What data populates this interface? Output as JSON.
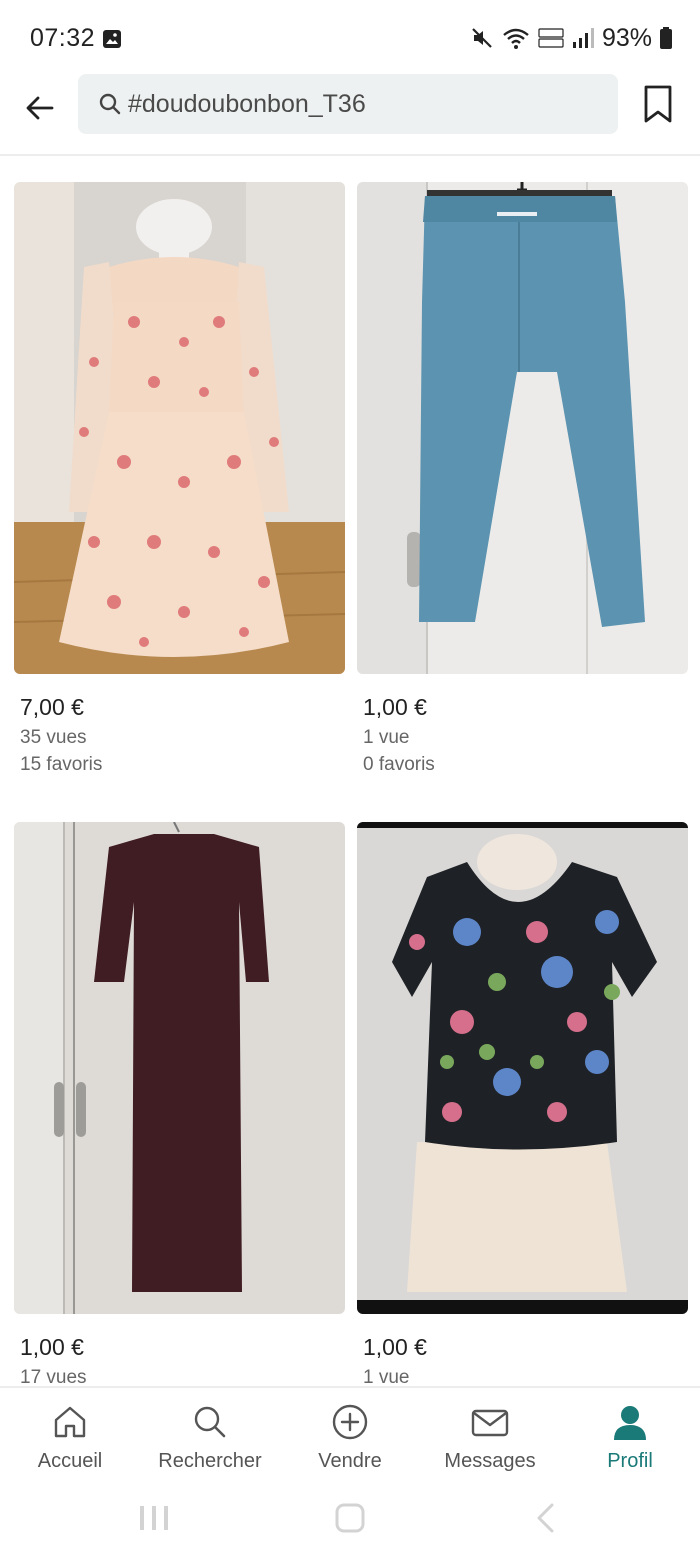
{
  "status_bar": {
    "time": "07:32",
    "battery": "93%",
    "icons": [
      "photo-icon",
      "mute-icon",
      "wifi-icon",
      "volte-icon",
      "signal-icon",
      "battery-icon"
    ]
  },
  "header": {
    "search_text": "#doudoubonbon_T36",
    "back_icon": "arrow-left-icon",
    "bookmark_icon": "bookmark-icon"
  },
  "items": [
    {
      "price": "7,00 €",
      "views": "35 vues",
      "favorites": "15 favoris",
      "image": "pink floral dress on mannequin"
    },
    {
      "price": "1,00 €",
      "views": "1 vue",
      "favorites": "0 favoris",
      "image": "blue trousers on hanger"
    },
    {
      "price": "1,00 €",
      "views": "17 vues",
      "favorites": "",
      "image": "long burgundy knit dress"
    },
    {
      "price": "1,00 €",
      "views": "1 vue",
      "favorites": "",
      "image": "black floral top on mannequin"
    }
  ],
  "bottom_nav": [
    {
      "label": "Accueil",
      "icon": "home-icon",
      "active": false
    },
    {
      "label": "Rechercher",
      "icon": "search-icon",
      "active": false
    },
    {
      "label": "Vendre",
      "icon": "plus-circle-icon",
      "active": false
    },
    {
      "label": "Messages",
      "icon": "mail-icon",
      "active": false
    },
    {
      "label": "Profil",
      "icon": "profile-icon",
      "active": true
    }
  ],
  "colors": {
    "accent": "#1a7a78",
    "search_bg": "#eef1f1",
    "text_secondary": "#666666"
  }
}
